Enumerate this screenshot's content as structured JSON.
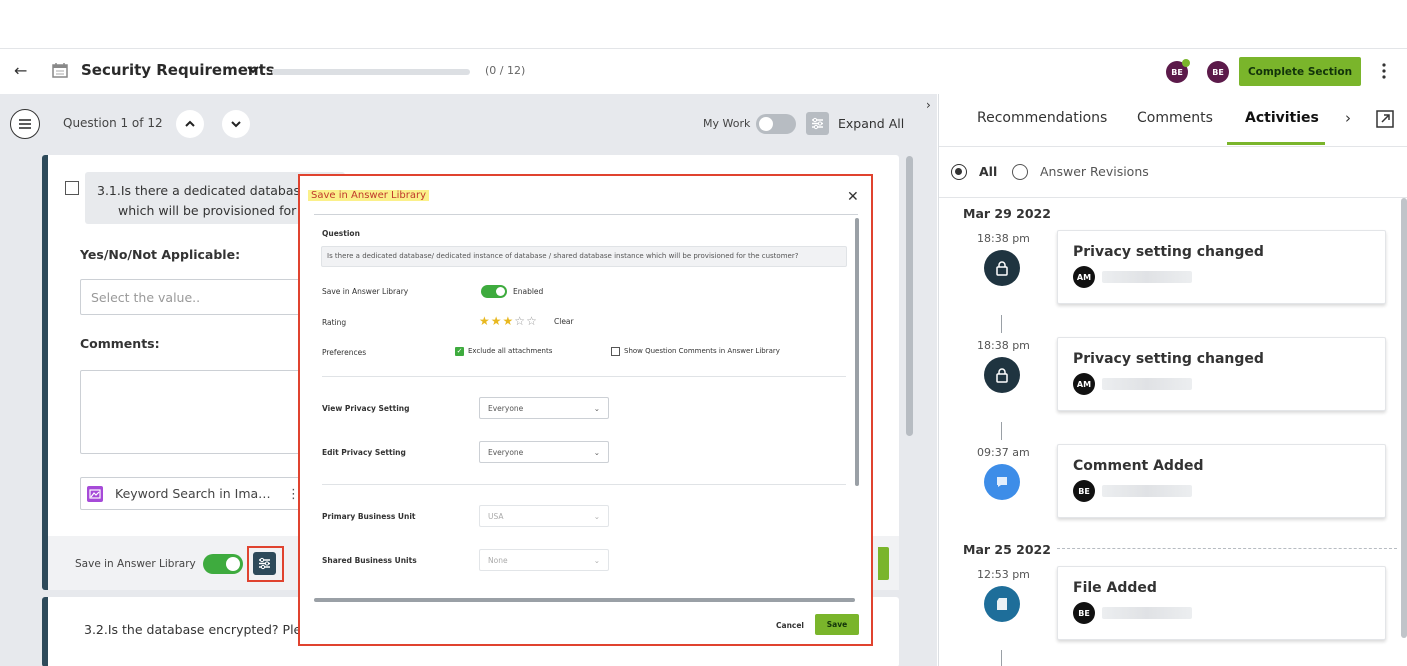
{
  "header": {
    "title": "Security Requirements",
    "progress_text": "(0 / 12)",
    "progress_fraction": 0,
    "avatars": [
      "BE",
      "BE"
    ],
    "complete_section_label": "Complete Section"
  },
  "toolbar": {
    "question_counter": "Question 1 of 12",
    "my_work_label": "My Work",
    "expand_all_label": "Expand All"
  },
  "question1": {
    "text_line1": "3.1.Is there a dedicated database/ d",
    "text_line2": "which will be provisioned for th",
    "answer_label": "Yes/No/Not Applicable:",
    "answer_placeholder": "Select the value..",
    "comments_label": "Comments:",
    "keyword_search_label": "Keyword Search in Ima…",
    "save_library_label": "Save in Answer Library"
  },
  "question2": {
    "text": "3.2.Is the database encrypted? Please"
  },
  "modal": {
    "title": "Save in Answer Library",
    "question_label": "Question",
    "question_text": "Is there a dedicated database/ dedicated instance of database / shared database instance which will be provisioned for the customer?",
    "save_in_library_label": "Save in Answer Library",
    "enabled_label": "Enabled",
    "rating_label": "Rating",
    "rating_value": 3,
    "rating_max": 5,
    "clear_label": "Clear",
    "preferences_label": "Preferences",
    "exclude_attachments_label": "Exclude all attachments",
    "exclude_attachments_checked": true,
    "show_comments_label": "Show Question Comments in Answer Library",
    "show_comments_checked": false,
    "view_privacy_label": "View Privacy Setting",
    "view_privacy_value": "Everyone",
    "edit_privacy_label": "Edit Privacy Setting",
    "edit_privacy_value": "Everyone",
    "primary_bu_label": "Primary Business Unit",
    "primary_bu_value": "USA",
    "shared_bu_label": "Shared Business Units",
    "shared_bu_value": "None",
    "cancel_label": "Cancel",
    "save_label": "Save"
  },
  "right_panel": {
    "tabs": [
      "Recommendations",
      "Comments",
      "Activities"
    ],
    "active_tab": "Activities",
    "filter_all": "All",
    "filter_revisions": "Answer Revisions",
    "groups": [
      {
        "date": "Mar 29 2022",
        "items": [
          {
            "time": "18:38 pm",
            "title": "Privacy setting changed",
            "user": "AM",
            "icon": "lock-icon"
          },
          {
            "time": "18:38 pm",
            "title": "Privacy setting changed",
            "user": "AM",
            "icon": "lock-icon"
          },
          {
            "time": "09:37 am",
            "title": "Comment Added",
            "user": "BE",
            "icon": "comment-icon"
          }
        ]
      },
      {
        "date": "Mar 25 2022",
        "items": [
          {
            "time": "12:53 pm",
            "title": "File Added",
            "user": "BE",
            "icon": "file-icon"
          }
        ]
      }
    ]
  },
  "colors": {
    "accent_green": "#7ab52b",
    "highlight_red": "#e0432f",
    "avatar_purple": "#5c1a4a",
    "card_border": "#2d4a5a",
    "lock_icon_bg": "#1f3440",
    "comment_icon_bg": "#3d8de8",
    "file_icon_bg": "#1e6e9a"
  }
}
